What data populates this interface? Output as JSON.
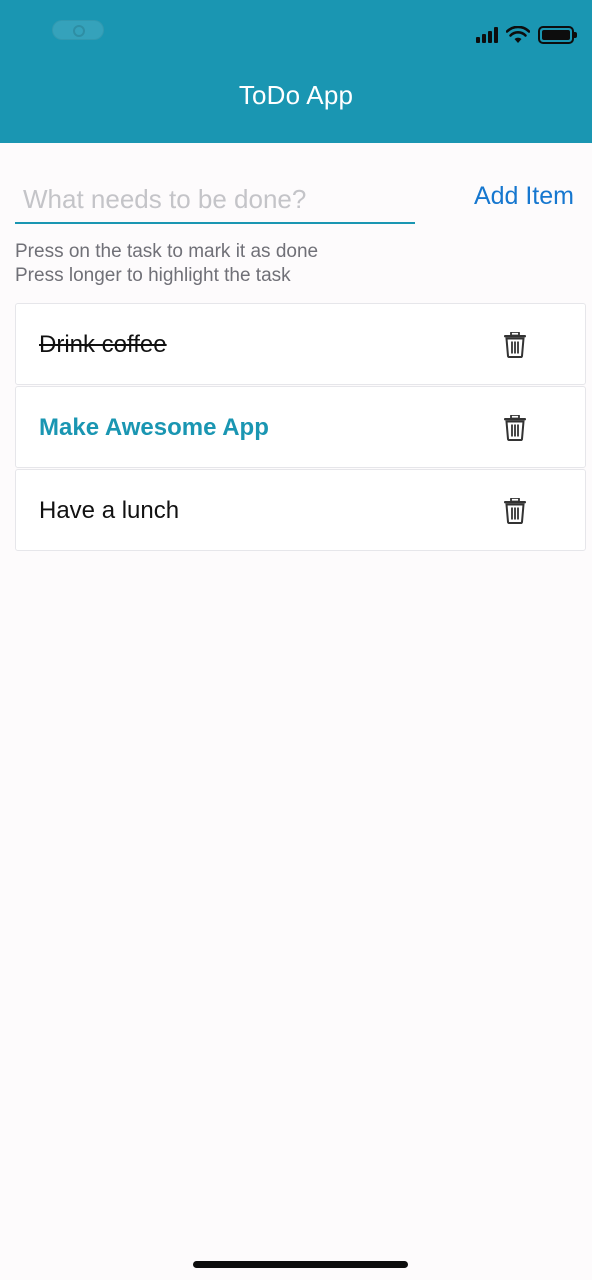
{
  "header": {
    "title": "ToDo App",
    "background": "#1a96b2",
    "status_icons": [
      "signal-icon",
      "wifi-icon",
      "battery-icon"
    ]
  },
  "input": {
    "placeholder": "What needs to be done?",
    "value": "",
    "add_label": "Add Item"
  },
  "hints": [
    "Press on the task to mark it as done",
    "Press longer to highlight the task"
  ],
  "tasks": [
    {
      "label": "Drink coffee",
      "state": "done"
    },
    {
      "label": "Make Awesome App",
      "state": "highlighted"
    },
    {
      "label": "Have a lunch",
      "state": "normal"
    }
  ],
  "colors": {
    "accent": "#1a96b2",
    "link": "#1677cf"
  }
}
